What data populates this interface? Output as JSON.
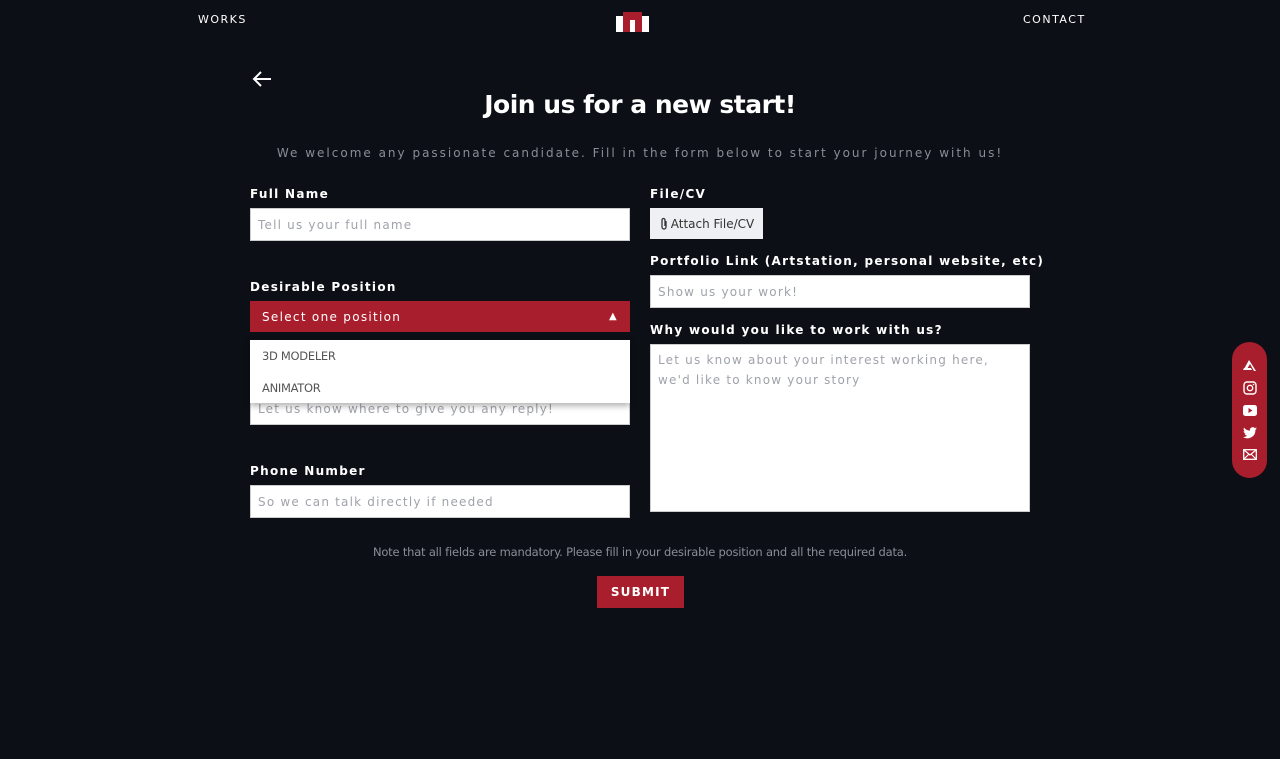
{
  "nav": {
    "works": "WORKS",
    "contact": "CONTACT",
    "logo": "MM logo"
  },
  "title": "Join us for a new start!",
  "subtitle": "We welcome any passionate candidate. Fill in the form below to start your journey with us!",
  "form": {
    "full_name": {
      "label": "Full Name",
      "placeholder": "Tell us your full name"
    },
    "position": {
      "label": "Desirable Position",
      "selected": "Select one position",
      "options": [
        "3D MODELER",
        "ANIMATOR"
      ]
    },
    "email": {
      "placeholder": "Let us know where to give you any reply!"
    },
    "phone": {
      "label": "Phone Number",
      "placeholder": "So we can talk directly if needed"
    },
    "file": {
      "label": "File/CV",
      "button": "Attach File/CV"
    },
    "portfolio": {
      "label": "Portfolio Link (Artstation, personal website, etc)",
      "placeholder": "Show us your work!"
    },
    "why": {
      "label": "Why would you like to work with us?",
      "placeholder": "Let us know about your interest working here, we'd like to know your story"
    },
    "note": "Note that all fields are mandatory. Please fill in your desirable position and all the required data.",
    "submit": "SUBMIT"
  },
  "social": [
    "artstation-icon",
    "instagram-icon",
    "youtube-icon",
    "twitter-icon",
    "mail-icon"
  ],
  "colors": {
    "background": "#0d0f17",
    "accent": "#a91e2c"
  }
}
